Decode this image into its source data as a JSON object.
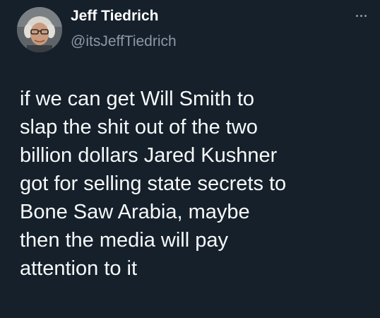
{
  "tweet": {
    "author": {
      "display_name": "Jeff Tiedrich",
      "handle": "@itsJeffTiedrich"
    },
    "text": "if we can get Will Smith to\nslap the shit out of the two\nbillion dollars Jared Kushner\ngot for selling state secrets to\nBone Saw Arabia, maybe\nthen the media will pay\nattention to it"
  },
  "icons": {
    "more": "more-horizontal-icon"
  },
  "colors": {
    "background": "#15202b",
    "primary_text": "#ffffff",
    "secondary_text": "#8b98a5"
  }
}
